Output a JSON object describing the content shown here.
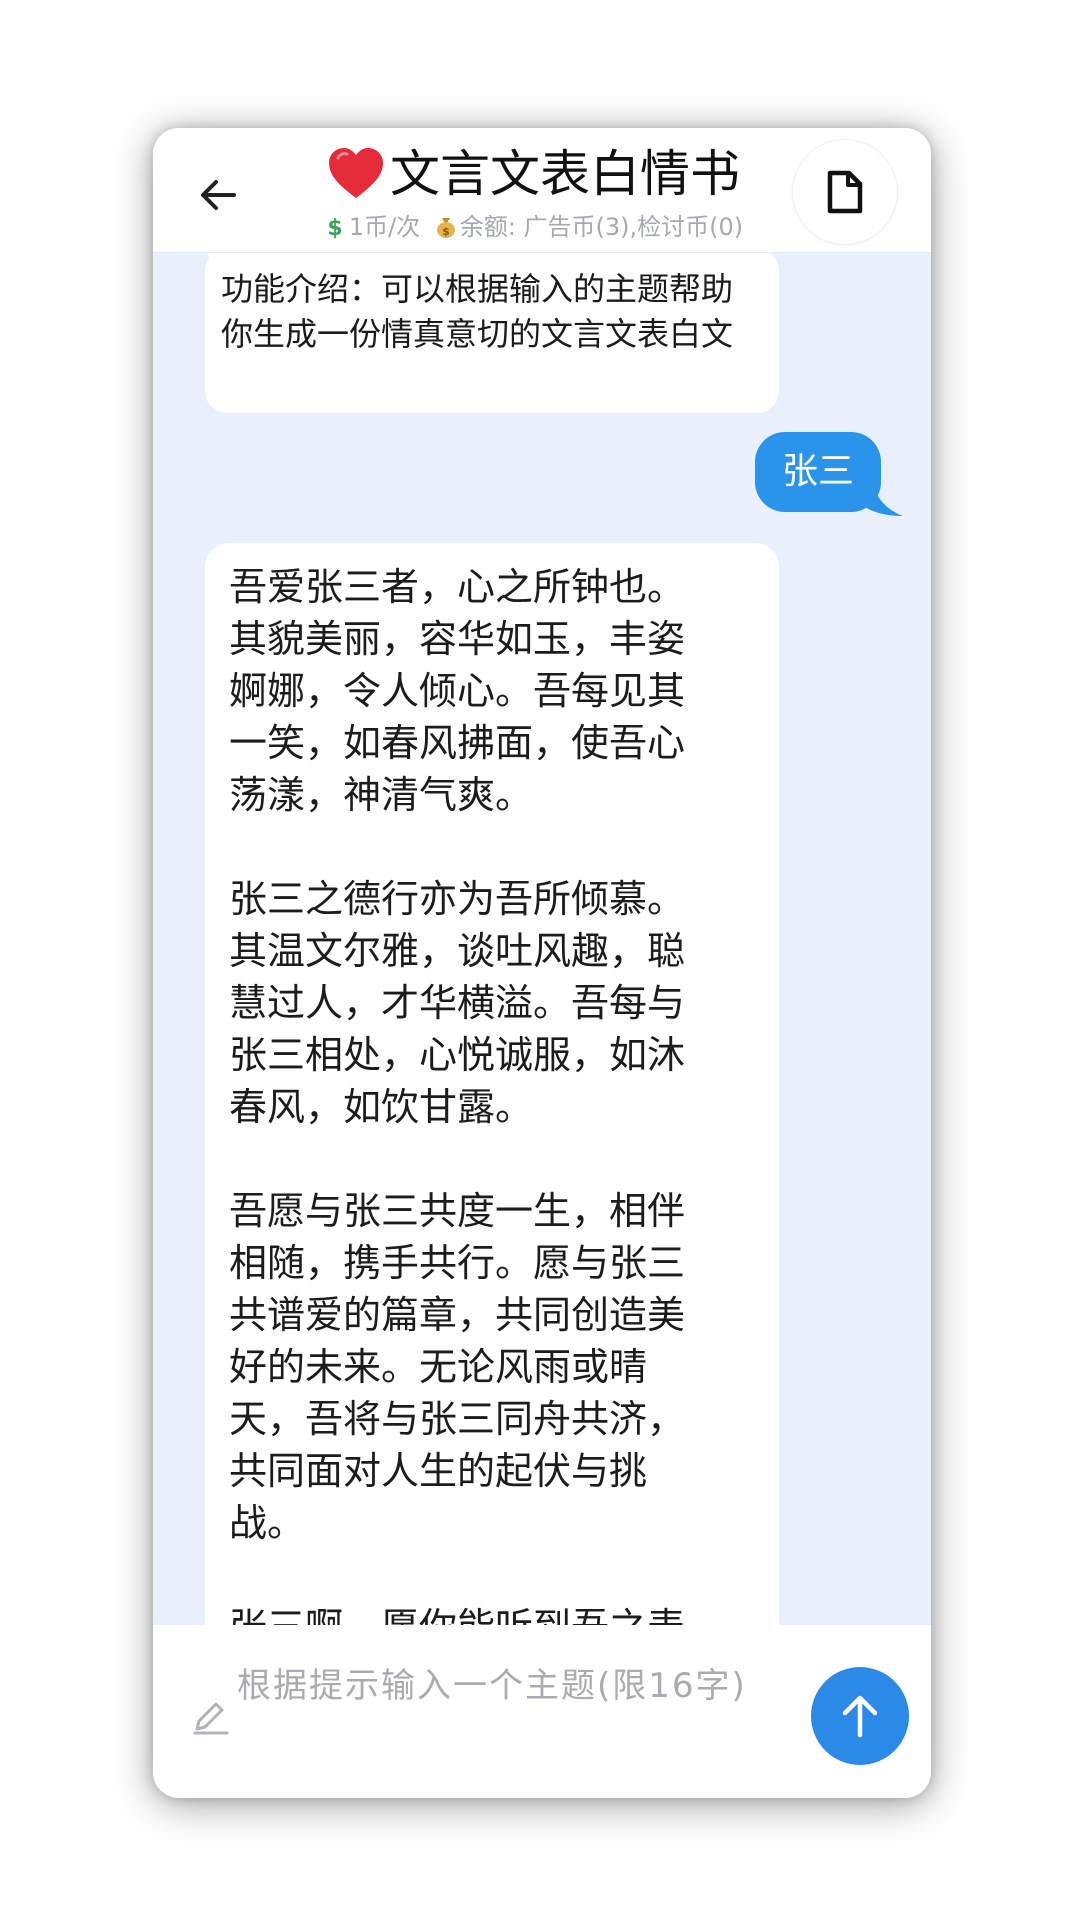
{
  "header": {
    "title": "文言文表白情书",
    "title_emoji": "heart-icon",
    "price": "1币/次",
    "balance": "余额: 广告币(3),检讨币(0)"
  },
  "messages": {
    "intro": "功能介绍：可以根据输入的主题帮助你生成一份情真意切的文言文表白文",
    "user": "张三",
    "reply_paragraphs": [
      "吾爱张三者，心之所钟也。其貌美丽，容华如玉，丰姿婀娜，令人倾心。吾每见其一笑，如春风拂面，使吾心荡漾，神清气爽。",
      "张三之德行亦为吾所倾慕。其温文尔雅，谈吐风趣，聪慧过人，才华横溢。吾每与张三相处，心悦诚服，如沐春风，如饮甘露。",
      "吾愿与张三共度一生，相伴相随，携手共行。愿与张三共谱爱的篇章，共同创造美好的未来。无论风雨或晴天，吾将与张三同舟共济，共同面对人生的起伏与挑战。",
      "张三啊，愿你能听到吾之表"
    ]
  },
  "input": {
    "placeholder": "根据提示输入一个主题(限16字)"
  },
  "colors": {
    "accent": "#2b8ae8",
    "user_bubble": "#2a93ea",
    "chat_background": "#e9f0fc"
  }
}
